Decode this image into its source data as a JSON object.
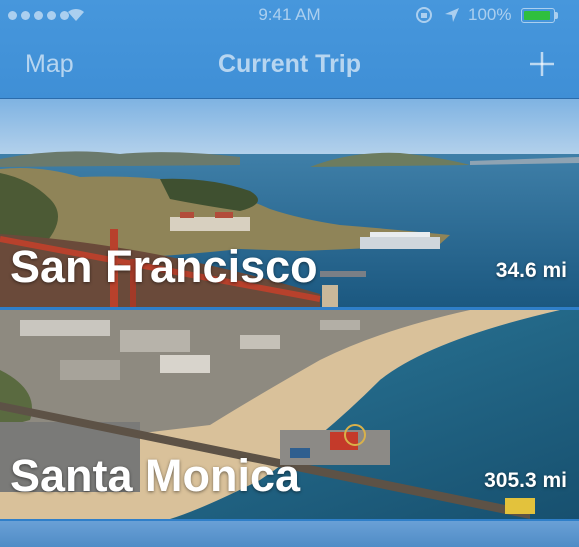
{
  "status_bar": {
    "time": "9:41 AM",
    "battery_percent": "100%",
    "signal_icon": "signal-dots-icon",
    "wifi_icon": "wifi-icon",
    "location_icon": "location-arrow-icon",
    "rotation_lock_icon": "rotation-lock-icon",
    "battery_icon": "battery-icon",
    "battery_level": 1.0
  },
  "nav_bar": {
    "left_label": "Map",
    "title": "Current Trip",
    "add_icon": "plus-icon"
  },
  "trips": [
    {
      "city": "San Francisco",
      "distance": "34.6 mi"
    },
    {
      "city": "Santa Monica",
      "distance": "305.3 mi"
    }
  ],
  "colors": {
    "nav_blue": "#4393da",
    "battery_green": "#2fbf3e",
    "ocean": "#1f6592",
    "sand": "#d9c19a"
  }
}
